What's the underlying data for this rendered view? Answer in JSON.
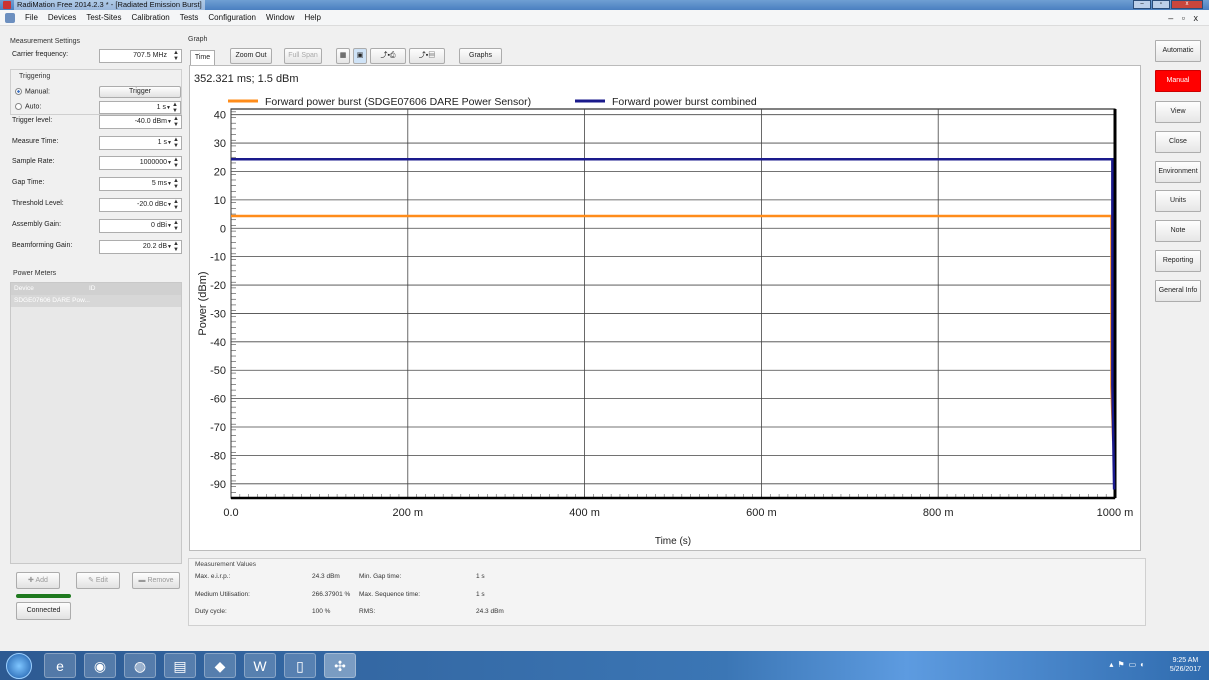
{
  "window": {
    "title": "RadiMation Free 2014.2.3 * - [Radiated Emission Burst]",
    "buttons": [
      "–",
      "▫",
      "x"
    ]
  },
  "menu": {
    "items": [
      "File",
      "Devices",
      "Test-Sites",
      "Calibration",
      "Tests",
      "Configuration",
      "Window",
      "Help"
    ],
    "mdi_controls": "– ▫ x"
  },
  "settings": {
    "header": "Measurement Settings",
    "carrier_frequency": {
      "label": "Carrier frequency:",
      "value": "707.5 MHz"
    },
    "triggering": {
      "header": "Triggering",
      "manual_label": "Manual:",
      "auto_label": "Auto:",
      "trigger_button": "Trigger",
      "auto_value": "1 s",
      "selected": "manual"
    },
    "fields": [
      {
        "key": "trigger-level",
        "label": "Trigger level:",
        "value": "-40.0 dBm"
      },
      {
        "key": "measure-time",
        "label": "Measure Time:",
        "value": "1 s"
      },
      {
        "key": "sample-rate",
        "label": "Sample Rate:",
        "value": "1000000"
      },
      {
        "key": "gap-time",
        "label": "Gap Time:",
        "value": "5 ms"
      },
      {
        "key": "threshold-level",
        "label": "Threshold Level:",
        "value": "-20.0 dBc"
      },
      {
        "key": "assembly-gain",
        "label": "Assembly Gain:",
        "value": "0 dBi"
      },
      {
        "key": "beamforming-gain",
        "label": "Beamforming Gain:",
        "value": "20.2 dB"
      }
    ]
  },
  "power_meters": {
    "header": "Power Meters",
    "columns": [
      "Device",
      "ID"
    ],
    "rows": [
      [
        "SDGE07606 DARE Pow...",
        ""
      ]
    ],
    "add": "Add",
    "edit": "Edit",
    "remove": "Remove",
    "connected": "Connected",
    "connected_color": "#1f7a1f"
  },
  "graph": {
    "header": "Graph",
    "tab": "Time",
    "toolbar": {
      "zoom_out": "Zoom Out",
      "full_span": "Full Span",
      "graphs": "Graphs"
    },
    "cursor_readout": "352.321 ms; 1.5 dBm"
  },
  "chart_data": {
    "type": "line",
    "xlabel": "Time (s)",
    "ylabel": "Power (dBm)",
    "xlim": [
      0,
      1000
    ],
    "ylim": [
      -95,
      42
    ],
    "xticks": [
      0,
      200,
      400,
      600,
      800,
      1000
    ],
    "xtick_labels": [
      "0.0",
      "200 m",
      "400 m",
      "600 m",
      "800 m",
      "1000 m"
    ],
    "yticks": [
      40,
      30,
      20,
      10,
      0,
      -10,
      -20,
      -30,
      -40,
      -50,
      -60,
      -70,
      -80,
      -90
    ],
    "grid": true,
    "legend": "top",
    "series": [
      {
        "name": "Forward power burst (SDGE07606 DARE Power Sensor)",
        "color": "#ff8c1a",
        "x": [
          0,
          996,
          996,
          998
        ],
        "y": [
          4.3,
          4.3,
          -56,
          -75
        ]
      },
      {
        "name": "Forward power burst combined",
        "color": "#1a1a8c",
        "x": [
          0,
          997,
          997,
          999
        ],
        "y": [
          24.3,
          24.3,
          -55,
          -92
        ]
      }
    ]
  },
  "measurement_values": {
    "header": "Measurement Values",
    "items": [
      {
        "label": "Max. e.i.r.p.:",
        "value": "24.3 dBm"
      },
      {
        "label": "Min. Gap time:",
        "value": "1 s"
      },
      {
        "label": "Medium Utilisation:",
        "value": "266.37901 %"
      },
      {
        "label": "Max. Sequence time:",
        "value": "1 s"
      },
      {
        "label": "Duty cycle:",
        "value": "100 %"
      },
      {
        "label": "RMS:",
        "value": "24.3 dBm"
      }
    ]
  },
  "right_panel": {
    "buttons": [
      "Automatic",
      "Manual",
      "View",
      "Close",
      "Environment",
      "Units",
      "Note",
      "Reporting",
      "General Info"
    ],
    "active": "Manual",
    "active_color": "#ff0000"
  },
  "taskbar": {
    "time": "9:25 AM",
    "date": "5/26/2017"
  }
}
